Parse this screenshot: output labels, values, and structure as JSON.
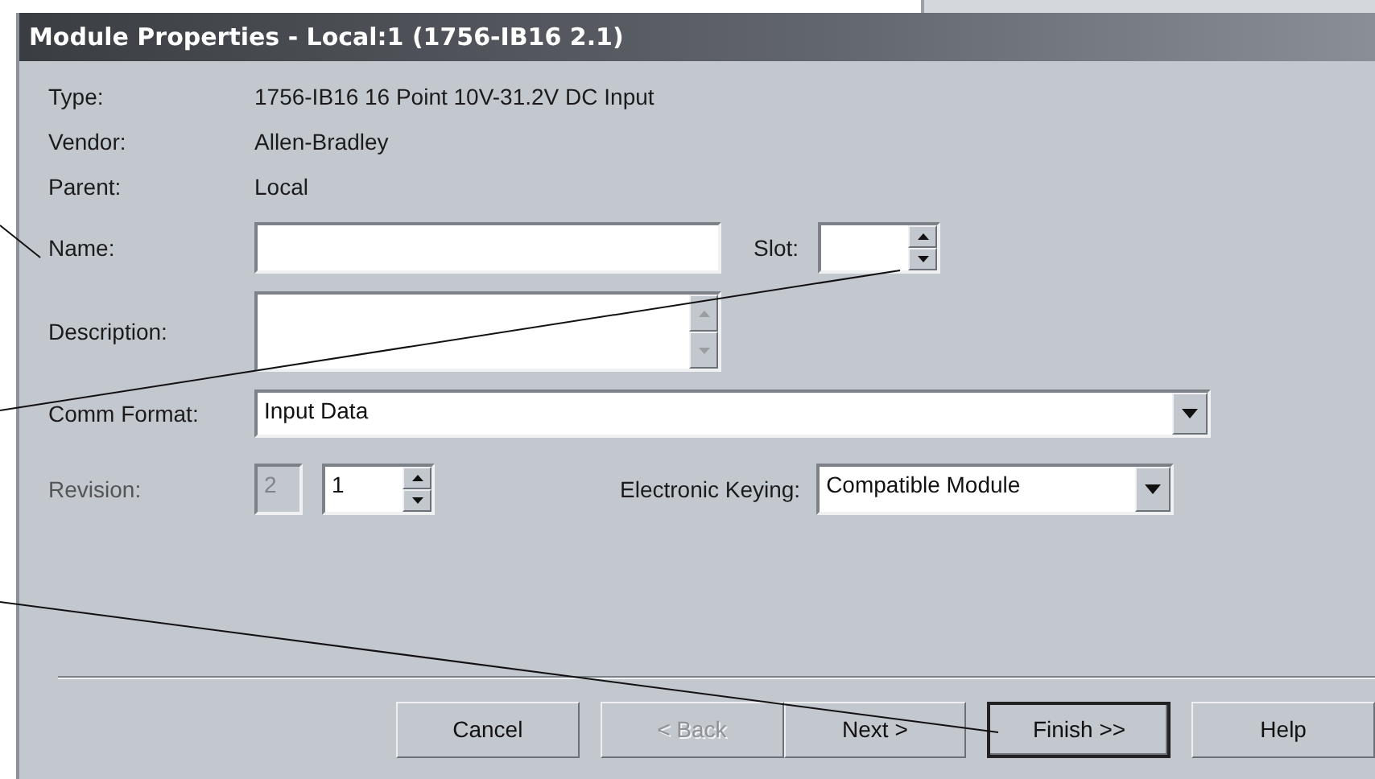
{
  "window": {
    "title": "Module Properties  - Local:1 (1756-IB16 2.1)"
  },
  "info": [
    {
      "label": "Type:",
      "value": "1756-IB16 16 Point 10V-31.2V DC Input"
    },
    {
      "label": "Vendor:",
      "value": "Allen-Bradley"
    },
    {
      "label": "Parent:",
      "value": "Local"
    }
  ],
  "name": {
    "label": "Name:"
  },
  "slot": {
    "label": "Slot:"
  },
  "description": {
    "label": "Description:"
  },
  "comm_format": {
    "label": "Comm Format:",
    "value": "Input Data"
  },
  "revision": {
    "label": "Revision:",
    "major": {
      "value": "2",
      "disabled": true
    },
    "minor": {
      "value": "1",
      "disabled": false
    }
  },
  "electronic_keying": {
    "label": "Electronic Keying:",
    "value": "Compatible Module"
  },
  "buttons": [
    {
      "label": "Cancel",
      "disabled": false,
      "default": false
    },
    {
      "label": "< Back",
      "disabled": true,
      "default": false
    },
    {
      "label": "Next >",
      "disabled": false,
      "default": false
    },
    {
      "label": "Finish >>",
      "disabled": false,
      "default": true
    },
    {
      "label": "Help",
      "disabled": false,
      "default": false
    }
  ]
}
